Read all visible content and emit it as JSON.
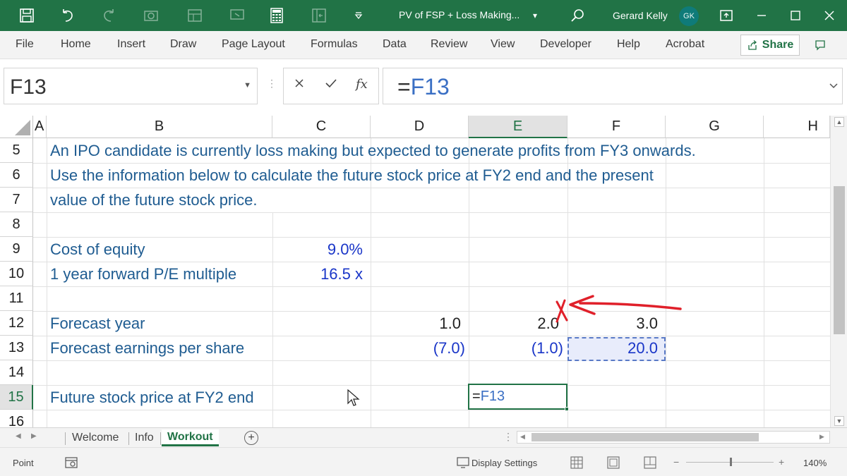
{
  "titlebar": {
    "document_title": "PV of FSP + Loss Making...",
    "user_name": "Gerard Kelly",
    "user_initials": "GK"
  },
  "ribbon": {
    "tabs": [
      "File",
      "Home",
      "Insert",
      "Draw",
      "Page Layout",
      "Formulas",
      "Data",
      "Review",
      "View",
      "Developer",
      "Help",
      "Acrobat"
    ],
    "share_label": "Share"
  },
  "formula_bar": {
    "name_box": "F13",
    "formula_prefix": "=",
    "formula_ref": "F13",
    "fx_label": "fx"
  },
  "grid": {
    "columns": [
      "A",
      "B",
      "C",
      "D",
      "E",
      "F",
      "G",
      "H"
    ],
    "rows": [
      "5",
      "6",
      "7",
      "8",
      "9",
      "10",
      "11",
      "12",
      "13",
      "14",
      "15",
      "16"
    ],
    "selected_column": "E",
    "selected_row": "15",
    "intro_line1": "An IPO candidate is currently loss making but expected to generate profits from FY3 onwards.",
    "intro_line2": "Use the information below to calculate the future stock price at FY2 end and the present",
    "intro_line3": "value of the future stock price.",
    "cost_of_equity_label": "Cost of equity",
    "cost_of_equity_value": "9.0%",
    "pe_label": "1 year forward P/E multiple",
    "pe_value": "16.5 x",
    "forecast_year_label": "Forecast year",
    "forecast_years": [
      "1.0",
      "2.0",
      "3.0"
    ],
    "eps_label": "Forecast earnings per share",
    "eps_values": [
      "(7.0)",
      "(1.0)",
      "20.0"
    ],
    "fsp_label": "Future stock price at FY2 end",
    "edit_prefix": "=",
    "edit_ref": "F13"
  },
  "sheets": {
    "tabs": [
      "Welcome",
      "Info",
      "Workout"
    ],
    "active": "Workout"
  },
  "status": {
    "mode": "Point",
    "display_settings": "Display Settings",
    "zoom": "140%"
  },
  "colors": {
    "excel_green": "#217346",
    "input_blue": "#1a36c8",
    "text_blue": "#1f5c91",
    "annotation_red": "#e0202a"
  }
}
